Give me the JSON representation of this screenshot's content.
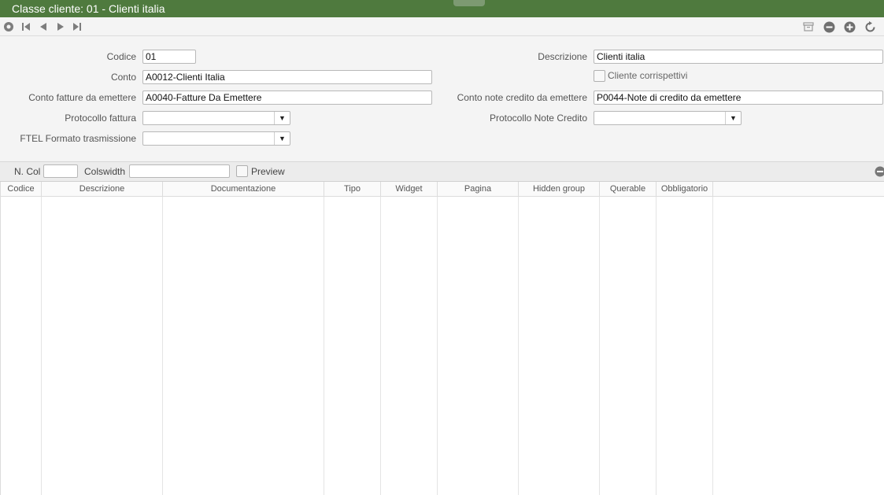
{
  "window": {
    "title": "Classe cliente: 01 - Clienti italia"
  },
  "toolbar": {
    "nav_icons": [
      "home-circle-icon",
      "first-record-icon",
      "previous-record-icon",
      "next-record-icon",
      "last-record-icon"
    ],
    "action_icons": [
      "archive-icon",
      "remove-icon",
      "add-icon",
      "refresh-icon"
    ]
  },
  "form": {
    "codice": {
      "label": "Codice",
      "value": "01"
    },
    "descrizione": {
      "label": "Descrizione",
      "value": "Clienti italia"
    },
    "conto": {
      "label": "Conto",
      "value": "A0012-Clienti Italia"
    },
    "cliente_corrispettivi": {
      "label": "Cliente corrispettivi",
      "checked": false
    },
    "conto_fatture": {
      "label": "Conto fatture da emettere",
      "value": "A0040-Fatture Da Emettere"
    },
    "conto_note_credito": {
      "label": "Conto note credito da emettere",
      "value": "P0044-Note di credito da emettere"
    },
    "protocollo_fattura": {
      "label": "Protocollo fattura",
      "value": ""
    },
    "protocollo_note_credito": {
      "label": "Protocollo Note Credito",
      "value": ""
    },
    "ftel_formato": {
      "label": "FTEL Formato trasmissione",
      "value": ""
    }
  },
  "gridbar": {
    "ncol_label": "N. Col",
    "ncol_value": "",
    "colswidth_label": "Colswidth",
    "colswidth_value": "",
    "preview_label": "Preview",
    "preview_checked": false
  },
  "grid": {
    "columns": [
      "Codice",
      "Descrizione",
      "Documentazione",
      "Tipo",
      "Widget",
      "Pagina",
      "Hidden group",
      "Querable",
      "Obbligatorio"
    ]
  },
  "colors": {
    "titlebar": "#4f7a3e",
    "toolbar_icon": "#7d7d7d",
    "panel_bg": "#f4f4f4"
  }
}
